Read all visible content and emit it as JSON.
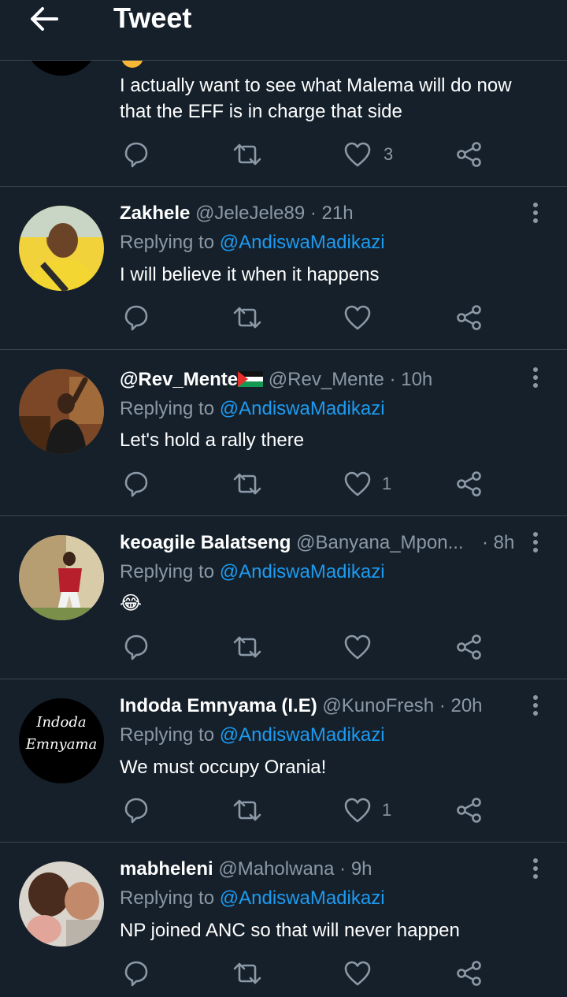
{
  "header": {
    "title": "Tweet",
    "back_icon": "arrow-left-icon"
  },
  "colors": {
    "background": "#15202b",
    "muted": "#8b98a5",
    "link": "#1d9bf0",
    "divider": "#38444d"
  },
  "partial_tweet": {
    "text_line1": "I actually want to see what Malema will do now",
    "text_line2": "that the EFF is in charge that side",
    "likes": "3"
  },
  "replies": [
    {
      "name": "Zakhele",
      "handle": "@JeleJele89",
      "time": "· 21h",
      "replying_prefix": "Replying to",
      "replying_to": "@AndiswaMadikazi",
      "text": "I will believe it when it happens",
      "likes": ""
    },
    {
      "name": "@Rev_Mente",
      "handle": "@Rev_Mente",
      "time": "· 10h",
      "replying_prefix": "Replying to",
      "replying_to": "@AndiswaMadikazi",
      "text": "Let's hold a rally there",
      "likes": "1"
    },
    {
      "name": "keoagile Balatseng",
      "handle": "@Banyana_Mpon...",
      "time": "· 8h",
      "replying_prefix": "Replying to",
      "replying_to": "@AndiswaMadikazi",
      "text": "😂",
      "likes": ""
    },
    {
      "name": "Indoda Emnyama (I.E)",
      "handle": "@KunoFresh",
      "time": "· 20h",
      "replying_prefix": "Replying to",
      "replying_to": "@AndiswaMadikazi",
      "text": "We must occupy Orania!",
      "likes": "1",
      "avatar_text_1": "Indoda",
      "avatar_text_2": "Emnyama"
    },
    {
      "name": "mabheleni",
      "handle": "@Maholwana",
      "time": "· 9h",
      "replying_prefix": "Replying to",
      "replying_to": "@AndiswaMadikazi",
      "text": "NP joined ANC so that will never happen",
      "likes": ""
    }
  ]
}
